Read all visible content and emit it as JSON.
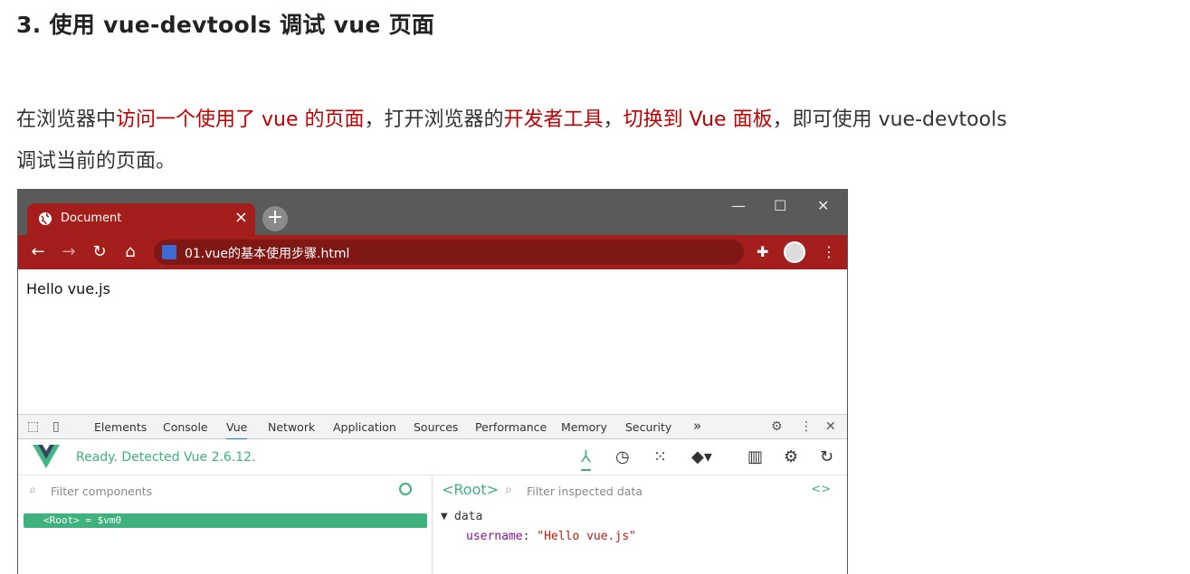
{
  "heading": "3. 使用 vue-devtools 调试 vue 页面",
  "paragraph": {
    "p1": "在浏览器中",
    "r1": "访问一个使用了 vue 的页面",
    "p2": "，打开浏览器的",
    "r2": "开发者工具",
    "p3": "，",
    "r3": "切换到 Vue 面板",
    "p4": "，即可使用 vue-devtools",
    "p5": "调试当前的页面。"
  },
  "browser": {
    "tab_title": "Document",
    "tab_close": "×",
    "new_tab": "+",
    "window_min": "—",
    "window_max": "☐",
    "window_close": "✕",
    "url": "01.vue的基本使用步骤.html",
    "page_content": "Hello vue.js"
  },
  "devtools": {
    "tabs": [
      "Elements",
      "Console",
      "Vue",
      "Network",
      "Application",
      "Sources",
      "Performance",
      "Memory",
      "Security"
    ],
    "active_tab": "Vue",
    "more": "»"
  },
  "vue_panel": {
    "status": "Ready. Detected Vue 2.6.12.",
    "filter_components_placeholder": "Filter components",
    "root_row": "<Root> = $vm0",
    "root_label": "<Root>",
    "filter_data_placeholder": "Filter inspected data",
    "code_toggle": "<>",
    "data_section": "data",
    "data_key": "username",
    "data_value": "\"Hello vue.js\""
  },
  "colors": {
    "heading": "#222222",
    "emphasis": "#c00000",
    "browser_chrome": "#a41f1b",
    "vue_green": "#3fb17c"
  }
}
